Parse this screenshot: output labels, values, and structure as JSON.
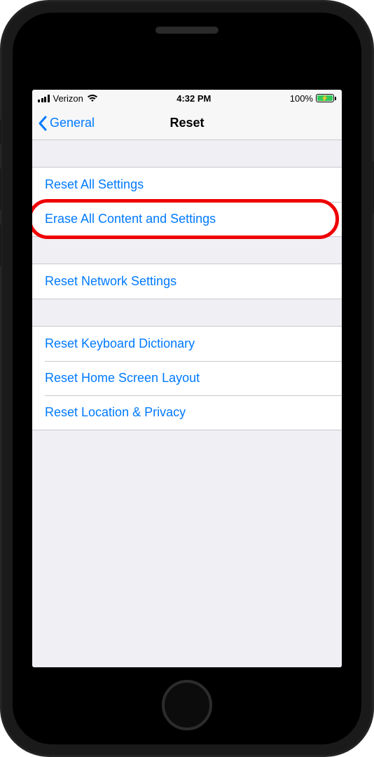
{
  "status_bar": {
    "carrier": "Verizon",
    "time": "4:32 PM",
    "battery_percent": "100%"
  },
  "nav": {
    "back_label": "General",
    "title": "Reset"
  },
  "groups": [
    {
      "rows": [
        {
          "name": "reset-all-settings",
          "label": "Reset All Settings",
          "highlighted": false
        },
        {
          "name": "erase-all-content-and-settings",
          "label": "Erase All Content and Settings",
          "highlighted": true
        }
      ]
    },
    {
      "rows": [
        {
          "name": "reset-network-settings",
          "label": "Reset Network Settings",
          "highlighted": false
        }
      ]
    },
    {
      "rows": [
        {
          "name": "reset-keyboard-dictionary",
          "label": "Reset Keyboard Dictionary",
          "highlighted": false
        },
        {
          "name": "reset-home-screen-layout",
          "label": "Reset Home Screen Layout",
          "highlighted": false
        },
        {
          "name": "reset-location-and-privacy",
          "label": "Reset Location & Privacy",
          "highlighted": false
        }
      ]
    }
  ]
}
